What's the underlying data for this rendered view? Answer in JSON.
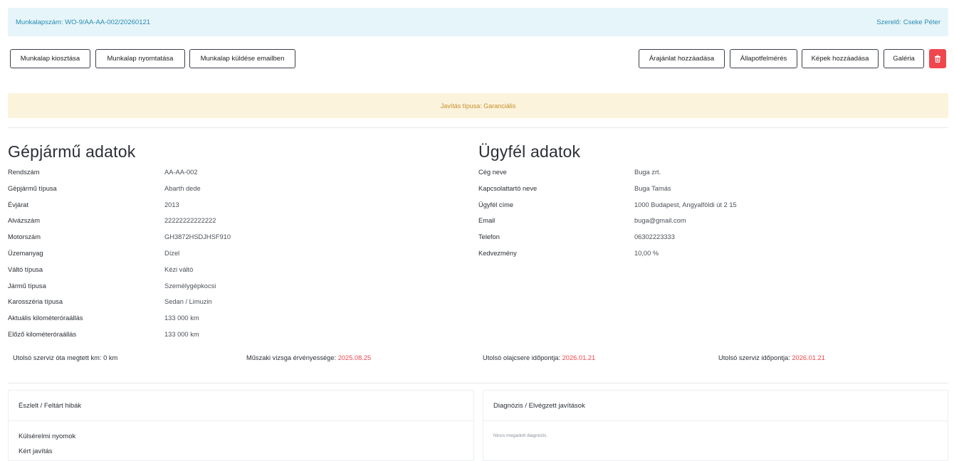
{
  "header": {
    "work_order_label": "Munkalapszám:",
    "work_order_number": "WO-9/AA-AA-002/20260121",
    "mechanic_label": "Szerelő:",
    "mechanic_name": "Cseke Péter"
  },
  "toolbar": {
    "assign": "Munkalap kiosztása",
    "print": "Munkalap nyomtatása",
    "email": "Munkalap küldése emailben",
    "quote": "Árajánlat hozzáadása",
    "inspection": "Állapotfelmérés",
    "add_images": "Képek hozzáadása",
    "gallery": "Galéria",
    "delete_icon": "trash-icon"
  },
  "repair_type": {
    "label": "Javítás típusa:",
    "value": "Garanciális"
  },
  "vehicle": {
    "title": "Gépjármű adatok",
    "rows": [
      {
        "k": "Rendszám",
        "v": "AA-AA-002"
      },
      {
        "k": "Gépjármű típusa",
        "v": "Abarth dede"
      },
      {
        "k": "Évjárat",
        "v": "2013"
      },
      {
        "k": "Alvázszám",
        "v": "22222222222222"
      },
      {
        "k": "Motorszám",
        "v": "GH3872HSDJHSF910"
      },
      {
        "k": "Üzemanyag",
        "v": "Dízel"
      },
      {
        "k": "Váltó típusa",
        "v": "Kézi váltó"
      },
      {
        "k": "Jármű típusa",
        "v": "Személygépkocsi"
      },
      {
        "k": "Karosszéria típusa",
        "v": "Sedan / Limuzin"
      },
      {
        "k": "Aktuális kilométeróraállás",
        "v": "133 000 km"
      },
      {
        "k": "Előző kilométeróraállás",
        "v": "133 000 km"
      }
    ]
  },
  "customer": {
    "title": "Ügyfél adatok",
    "rows": [
      {
        "k": "Cég neve",
        "v": "Buga zrt."
      },
      {
        "k": "Kapcsolattartó neve",
        "v": "Buga Tamás"
      },
      {
        "k": "Ügyfél címe",
        "v": "1000 Budapest, Angyalföldi út 2 15"
      },
      {
        "k": "Email",
        "v": "buga@gmail.com"
      },
      {
        "k": "Telefon",
        "v": "06302223333"
      },
      {
        "k": "Kedvezmény",
        "v": "10,00 %"
      }
    ]
  },
  "stats": {
    "km_since_service": "Utolsó szerviz óta megtett km: 0 km",
    "inspection_label": "Műszaki vizsga érvényessége:",
    "inspection_value": "2025.08.25",
    "oil_label": "Utolsó olajcsere időpontja:",
    "oil_value": "2026.01.21",
    "service_label": "Utolsó szerviz időpontja:",
    "service_value": "2026.01.21"
  },
  "faults": {
    "title": "Észlelt / Feltárt hibák",
    "items": [
      "Külsérelmi nyomok",
      "Kért javítás"
    ]
  },
  "diagnosis": {
    "title": "Diagnózis / Elvégzett javítások",
    "empty": "Nincs megadott diagnózis."
  },
  "colors": {
    "accent": "#2a8bb0",
    "danger": "#f0474e",
    "warning_bg": "#fcf3dd",
    "warning_text": "#c6902c",
    "info_bg": "#e6f5fa"
  }
}
